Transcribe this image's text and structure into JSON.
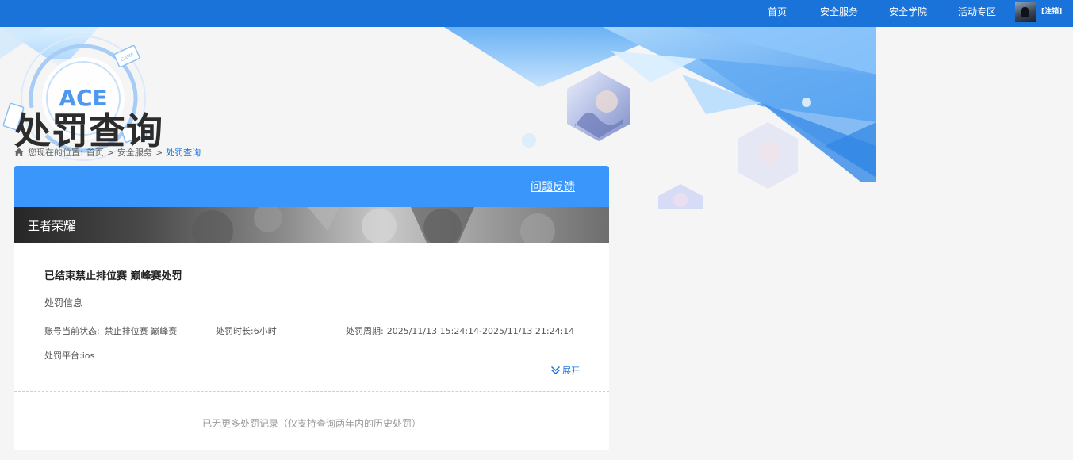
{
  "nav": {
    "items": [
      {
        "label": "首页"
      },
      {
        "label": "安全服务"
      },
      {
        "label": "安全学院"
      },
      {
        "label": "活动专区"
      }
    ],
    "logout_label": "[注销]"
  },
  "banner": {
    "title": "处罚查询",
    "emblem_text": "ACE",
    "game_tag": "GAME"
  },
  "breadcrumb": {
    "prefix": "您现在的位置:",
    "home": "首页",
    "section": "安全服务",
    "current": "处罚查询",
    "separator": ">"
  },
  "card": {
    "feedback_label": "问题反馈",
    "game_name": "王者荣耀",
    "record": {
      "title": "已结束禁止排位赛 巅峰赛处罚",
      "info_heading": "处罚信息",
      "status_label": "账号当前状态:",
      "status_value": "禁止排位赛 巅峰赛",
      "duration_label": "处罚时长:",
      "duration_value": "6小时",
      "period_label": "处罚周期:",
      "period_value": "2025/11/13 15:24:14-2025/11/13 21:24:14",
      "platform_label": "处罚平台:",
      "platform_value": "ios",
      "expand_label": "展开"
    },
    "no_more_text": "已无更多处罚记录（仅支持查询两年内的历史处罚）"
  },
  "colors": {
    "nav_bg": "#1a73d9",
    "card_header_bg": "#3a96fb",
    "link": "#1a73d9",
    "page_bg": "#f5f5f5"
  },
  "icons": {
    "breadcrumb": "home-icon",
    "expand": "double-chevron-down-icon"
  }
}
